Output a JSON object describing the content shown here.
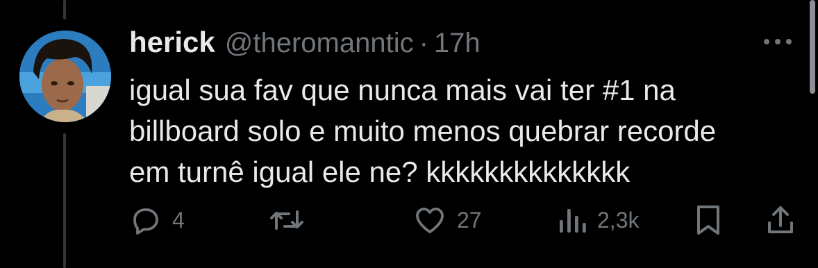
{
  "tweet": {
    "author_name": "herick",
    "author_handle": "@theromanntic",
    "separator": "·",
    "time": "17h",
    "text": "igual sua fav que nunca mais vai ter #1 na\nbillboard solo e muito menos quebrar recorde\nem turnê igual ele ne? kkkkkkkkkkkkkk"
  },
  "actions": {
    "reply_count": "4",
    "like_count": "27",
    "views_count": "2,3k"
  },
  "icons": {
    "reply": "reply-icon",
    "retweet": "retweet-icon",
    "like": "heart-icon",
    "views": "views-icon",
    "bookmark": "bookmark-icon",
    "share": "share-icon",
    "more": "more-icon"
  },
  "colors": {
    "background": "#000000",
    "text": "#e7e9ea",
    "secondary": "#71767b"
  }
}
